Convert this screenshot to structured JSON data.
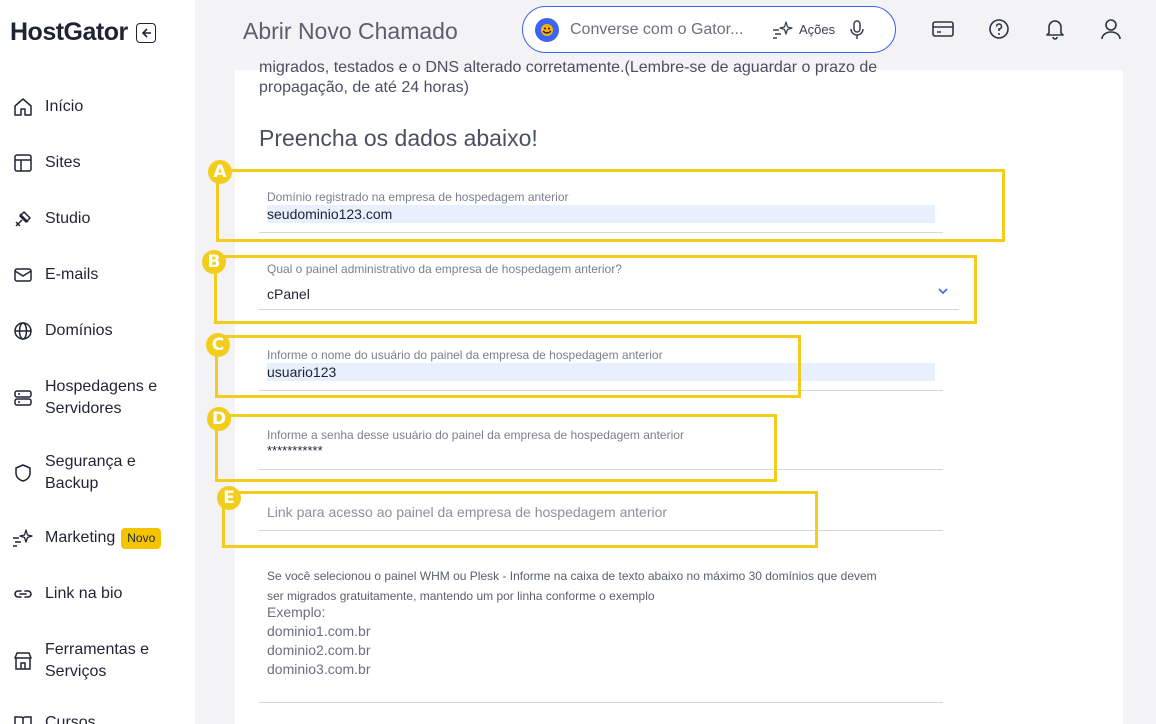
{
  "brand": {
    "name": "HostGator"
  },
  "sidebar": {
    "items": [
      {
        "label": "Início"
      },
      {
        "label": "Sites"
      },
      {
        "label": "Studio"
      },
      {
        "label": "E-mails"
      },
      {
        "label": "Domínios"
      },
      {
        "label": "Hospedagens e Servidores"
      },
      {
        "label": "Segurança e Backup"
      },
      {
        "label": "Marketing",
        "badge": "Novo"
      },
      {
        "label": "Link na bio"
      },
      {
        "label": "Ferramentas e Serviços"
      },
      {
        "label": "Cursos"
      }
    ]
  },
  "header": {
    "title": "Abrir Novo Chamado",
    "search_placeholder": "Converse com o Gator...",
    "actions_label": "Ações"
  },
  "form": {
    "intro_line1": "migrados, testados e o DNS alterado corretamente.(Lembre-se de aguardar o prazo de",
    "intro_line2": "propagação, de até 24 horas)",
    "section_title": "Preencha os dados abaixo!",
    "domain": {
      "label": "Domínio registrado na empresa de hospedagem anterior",
      "value": "seudominio123.com"
    },
    "panel": {
      "label": "Qual o painel administrativo da empresa de hospedagem anterior?",
      "value": "cPanel"
    },
    "username": {
      "label": "Informe o nome do usuário do painel da empresa de hospedagem anterior",
      "value": "usuario123"
    },
    "password": {
      "label": "Informe a senha desse usuário do painel da empresa de hospedagem anterior",
      "value": "***********"
    },
    "link": {
      "placeholder": "Link para acesso ao painel da empresa de hospedagem anterior"
    },
    "domains_help_line1": "Se você selecionou o painel WHM ou Plesk - Informe na caixa de texto abaixo no máximo 30 domínios que devem",
    "domains_help_line2": "ser migrados gratuitamente, mantendo um por linha conforme o exemplo",
    "domains_example": [
      "Exemplo:",
      "dominio1.com.br",
      "dominio2.com.br",
      "dominio3.com.br"
    ]
  },
  "annotations": [
    "A",
    "B",
    "C",
    "D",
    "E"
  ],
  "colors": {
    "annotation": "#f2cd1c",
    "accent": "#3b64f0",
    "badge": "#f5c400"
  }
}
